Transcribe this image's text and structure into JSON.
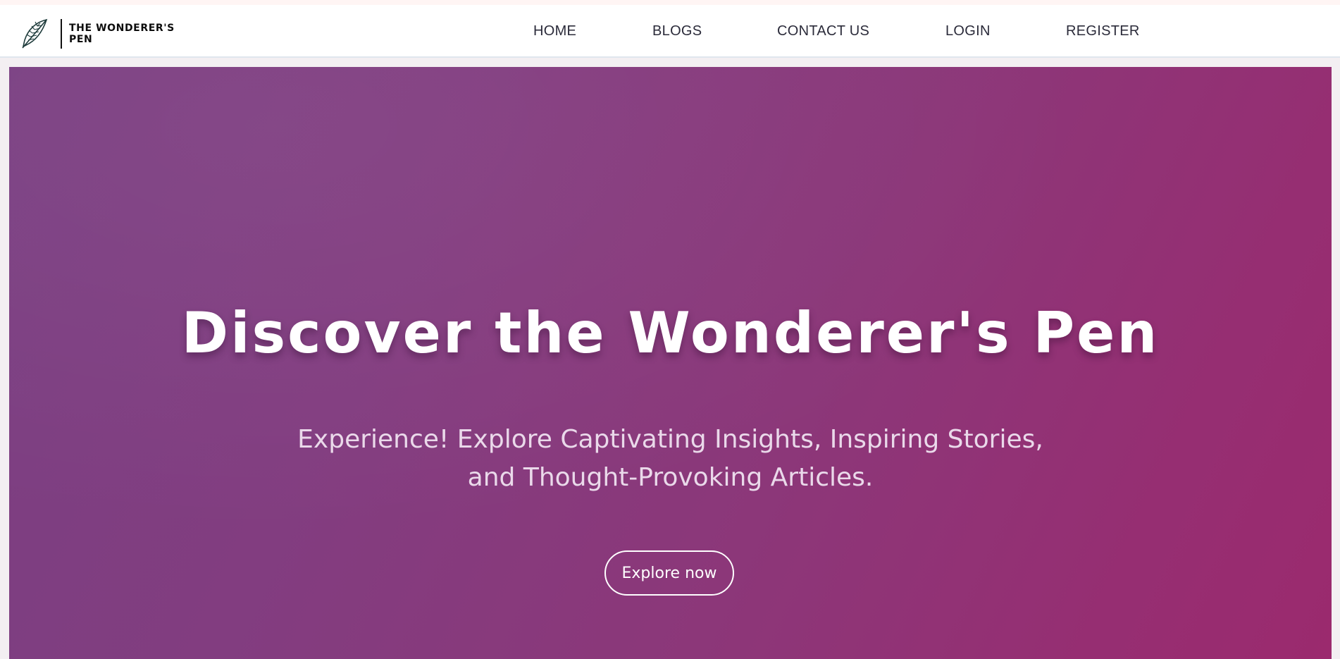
{
  "brand": {
    "name_line1": "THE WONDERER'S",
    "name_line2": "PEN",
    "logo_icon": "feather-icon"
  },
  "nav": {
    "items": [
      {
        "label": "HOME"
      },
      {
        "label": "BLOGS"
      },
      {
        "label": "CONTACT US"
      },
      {
        "label": "LOGIN"
      },
      {
        "label": "REGISTER"
      }
    ]
  },
  "hero": {
    "title": "Discover the Wonderer's Pen",
    "subtitle_line1": "Experience! Explore Captivating Insights, Inspiring Stories,",
    "subtitle_line2": "and Thought-Provoking Articles.",
    "cta_label": "Explore now"
  },
  "colors": {
    "hero_gradient_start": "#7a3f82",
    "hero_gradient_end": "#9b2a6e",
    "nav_text": "#2b2b3a",
    "navbar_bg": "#ffffff"
  }
}
